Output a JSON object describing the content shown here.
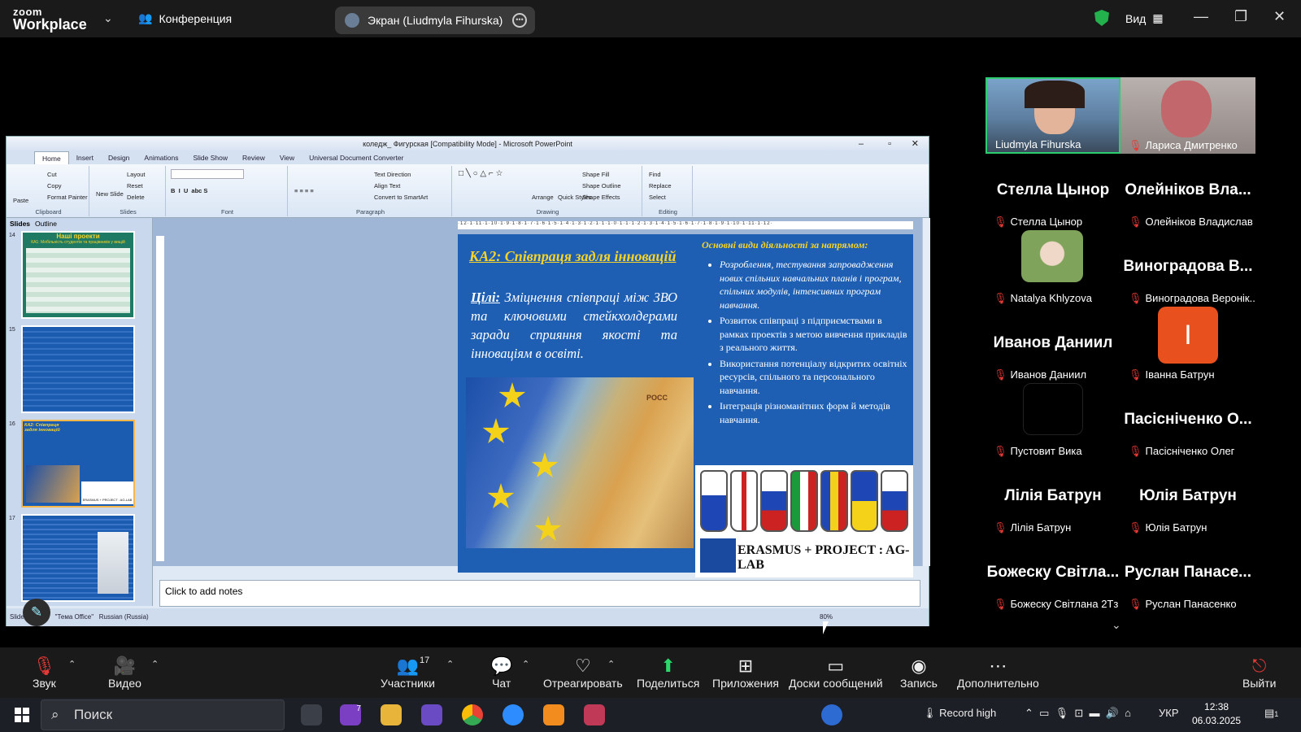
{
  "app": {
    "logo_line1": "zoom",
    "logo_line2": "Workplace",
    "meeting_label": "Конференция",
    "screen_share_label": "Экран (Liudmyla Fihurska)",
    "view_label": "Вид"
  },
  "ppt": {
    "title": "коледж_ Фигурская [Compatibility Mode] - Microsoft PowerPoint",
    "tabs": [
      "Home",
      "Insert",
      "Design",
      "Animations",
      "Slide Show",
      "Review",
      "View",
      "Universal Document Converter"
    ],
    "ribbon": {
      "paste": "Paste",
      "cut": "Cut",
      "copy": "Copy",
      "format_painter": "Format Painter",
      "new_slide": "New Slide",
      "layout": "Layout",
      "reset": "Reset",
      "delete": "Delete",
      "text_direction": "Text Direction",
      "align_text": "Align Text",
      "convert_smartart": "Convert to SmartArt",
      "arrange": "Arrange",
      "quick_styles": "Quick Styles",
      "shape_fill": "Shape Fill",
      "shape_outline": "Shape Outline",
      "shape_effects": "Shape Effects",
      "find": "Find",
      "replace": "Replace",
      "select": "Select",
      "groups": [
        "Clipboard",
        "Slides",
        "Font",
        "Paragraph",
        "Drawing",
        "Editing"
      ]
    },
    "thumb_tabs": [
      "Slides",
      "Outline"
    ],
    "thumb_numbers": [
      "14",
      "15",
      "16",
      "17"
    ],
    "thumb14_title": "Наші проекти",
    "thumb14_subtitle": "КА1: Мобільність студентів та працівників у вищій",
    "thumb16_title": "КА2: Співпраця задля інновацій",
    "thumb16_caption": "ERASMUS + PROJECT : AG-LAB",
    "notes_placeholder": "Click to add notes",
    "status": {
      "slide": "Slide 16 of 63",
      "theme": "\"Тема Office\"",
      "language": "Russian (Russia)",
      "zoom": "80%"
    },
    "ruler_text": "·12·1·11·1·10·1·9·1·8·1·7·1·6·1·5·1·4·1·3·1·2·1·1·1·0·1·1·1·2·1·3·1·4·1·5·1·6·1·7·1·8·1·9·1·10·1·11·1·12·"
  },
  "slide": {
    "title": "КА2: Співпраця задля інновацій",
    "goal_label": "Цілі:",
    "goal_text": " Зміцнення співпраці між ЗВО та ключовими стейкхолдерами заради сприяння якості та інноваціям в освіті.",
    "right_heading": "Основні види діяльності за напрямом:",
    "bullets": [
      "Розроблення, тестування запровадження нових спільних навчальних планів і програм, спільних модулів, інтенсивних програм навчання.",
      "Розвиток співпраці з підприємствами в рамках проектів з метою вивчення прикладів з реального життя.",
      "Використання потенціалу відкритих освітніх ресурсів, спільного та персонального навчання.",
      "Інтеграція різноманітних форм й методів навчання."
    ],
    "map_label": "POCC",
    "logo_text": "ERASMUS + PROJECT : AG-LAB"
  },
  "participants": [
    {
      "big": "",
      "name": "Liudmyla Fihurska",
      "video": true
    },
    {
      "big": "",
      "name": "Лариса Дмитренко",
      "video": true
    },
    {
      "big": "Стелла Цынор",
      "name": "Стелла Цынор"
    },
    {
      "big": "Олейніков Вла...",
      "name": "Олейніков Владислав"
    },
    {
      "big": "",
      "name": "Natalya Khlyzova",
      "video": true
    },
    {
      "big": "Виноградова В...",
      "name": "Виноградова Веронік..."
    },
    {
      "big": "Иванов Даниил",
      "name": "Иванов Даниил"
    },
    {
      "big": "І",
      "name": "Іванна Батрун"
    },
    {
      "big": "",
      "name": "Пустовит Вика"
    },
    {
      "big": "Пасісніченко О...",
      "name": "Пасісніченко Олег"
    },
    {
      "big": "Лілія Батрун",
      "name": "Лілія Батрун"
    },
    {
      "big": "Юлія Батрун",
      "name": "Юлія Батрун"
    },
    {
      "big": "Божеску Світла...",
      "name": "Божеску Світлана 2Тз"
    },
    {
      "big": "Руслан Панасе...",
      "name": "Руслан Панасенко"
    }
  ],
  "toolbar": {
    "audio": "Звук",
    "video": "Видео",
    "participants": "Участники",
    "participants_count": "17",
    "chat": "Чат",
    "react": "Отреагировать",
    "share": "Поделиться",
    "apps": "Приложения",
    "whiteboards": "Доски сообщений",
    "record": "Запись",
    "more": "Дополнительно",
    "leave": "Выйти"
  },
  "taskbar": {
    "search": "Поиск",
    "badge": "7",
    "record": "Record high",
    "lang": "УКР",
    "time": "12:38",
    "date": "06.03.2025",
    "notif": "1"
  }
}
